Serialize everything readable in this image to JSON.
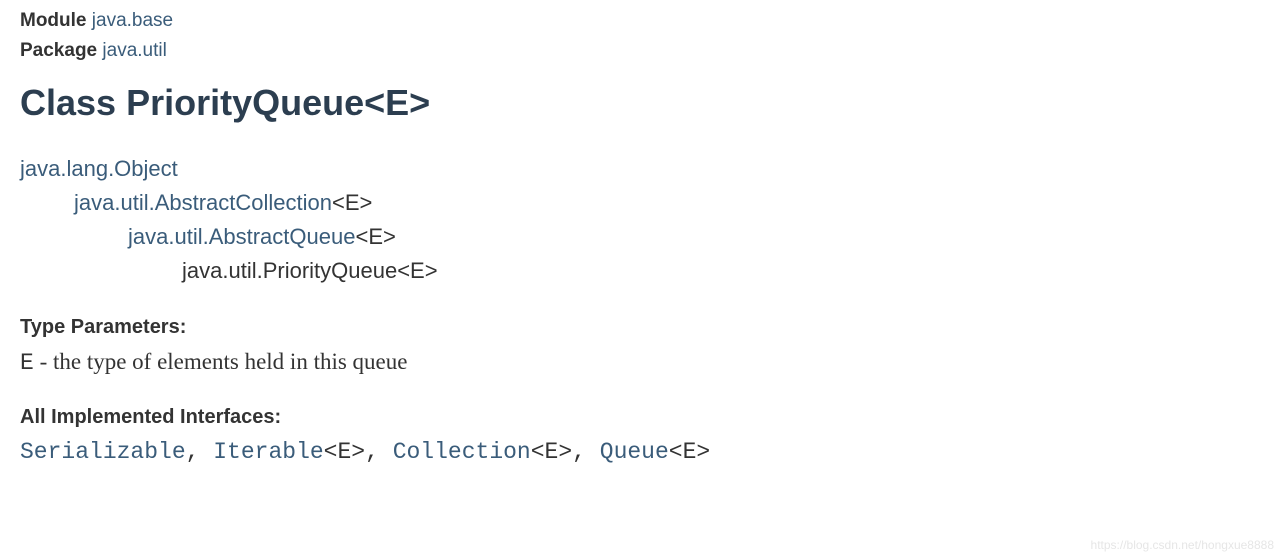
{
  "module": {
    "label": "Module",
    "link": "java.base"
  },
  "package": {
    "label": "Package",
    "link": "java.util"
  },
  "classTitle": "Class PriorityQueue<E>",
  "inheritance": {
    "l0": {
      "link": "java.lang.Object",
      "suffix": ""
    },
    "l1": {
      "link": "java.util.AbstractCollection",
      "suffix": "<E>"
    },
    "l2": {
      "link": "java.util.AbstractQueue",
      "suffix": "<E>"
    },
    "l3": {
      "text": "java.util.PriorityQueue<E>"
    }
  },
  "typeParams": {
    "heading": "Type Parameters:",
    "code": "E",
    "desc": " - the type of elements held in this queue"
  },
  "interfaces": {
    "heading": "All Implemented Interfaces:",
    "items": [
      {
        "name": "Serializable",
        "suffix": ""
      },
      {
        "name": "Iterable",
        "suffix": "<E>"
      },
      {
        "name": "Collection",
        "suffix": "<E>"
      },
      {
        "name": "Queue",
        "suffix": "<E>"
      }
    ],
    "sep": ", "
  },
  "watermark": "https://blog.csdn.net/hongxue8888"
}
